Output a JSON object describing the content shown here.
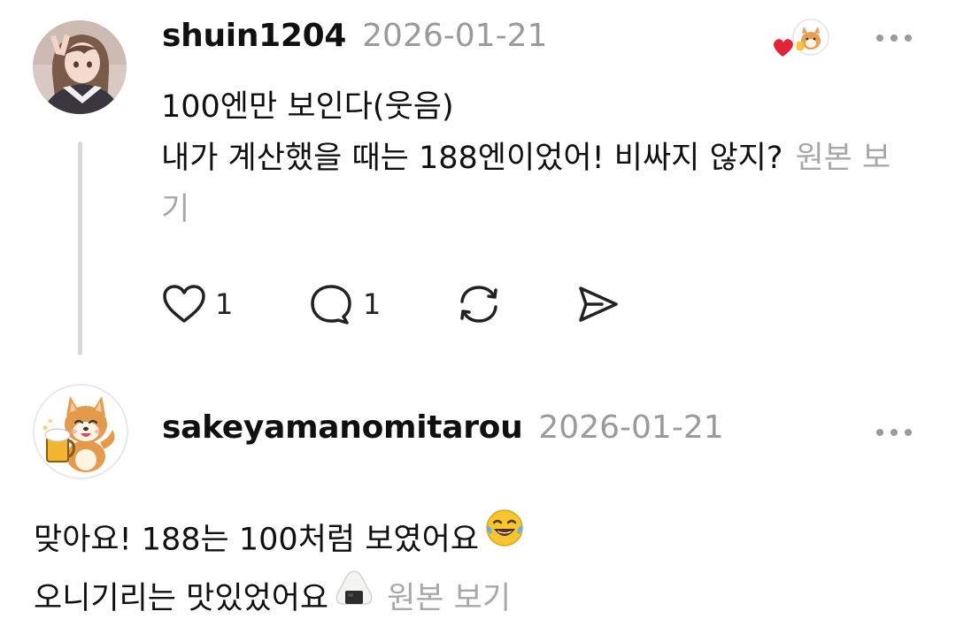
{
  "post1": {
    "username": "shuin1204",
    "date": "2026-01-21",
    "body_line1": "100엔만 보인다(웃음)",
    "body_line2": "내가 계산했을 때는 188엔이었어! 비싸지 않지?",
    "view_original": "원본 보기",
    "like_count": "1",
    "reply_count": "1"
  },
  "post2": {
    "username": "sakeyamanomitarou",
    "date": "2026-01-21",
    "body_line1": "맞아요! 188는 100처럼 보였어요",
    "body_line2": "오니기리는 맛있었어요",
    "view_original": "원본 보기"
  },
  "colors": {
    "text": "#101010",
    "muted": "#9a9a9a",
    "thread_line": "#d9d9d9",
    "heart_red": "#e0243a"
  },
  "icons": [
    "heart-icon",
    "comment-icon",
    "repost-icon",
    "share-icon",
    "more-icon",
    "laughing-emoji-icon",
    "onigiri-emoji-icon"
  ]
}
